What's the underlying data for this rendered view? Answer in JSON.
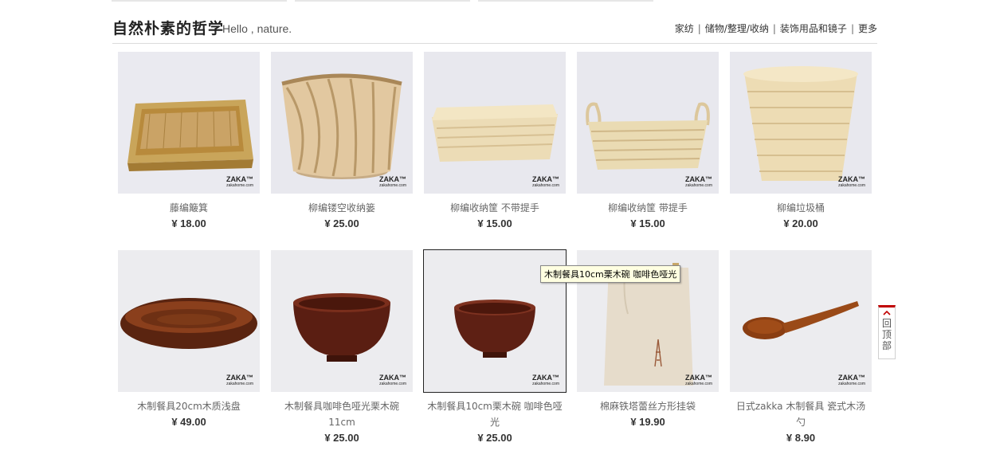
{
  "section": {
    "title": "自然朴素的哲学",
    "subtitle": "Hello , nature.",
    "categories": [
      "家纺",
      "储物/整理/收纳",
      "装饰用品和镜子",
      "更多"
    ]
  },
  "brand": {
    "logo": "ZAKA™",
    "site": "zakahome.com"
  },
  "products": [
    {
      "name": "藤编簸箕",
      "price": "¥ 18.00",
      "icon": "rattan-tray"
    },
    {
      "name": "柳编镂空收纳篓",
      "price": "¥ 25.00",
      "icon": "wicker-basket"
    },
    {
      "name": "柳编收纳筐 不带提手",
      "price": "¥ 15.00",
      "icon": "straw-basket"
    },
    {
      "name": "柳编收纳筐 带提手",
      "price": "¥ 15.00",
      "icon": "straw-basket-handles"
    },
    {
      "name": "柳编垃圾桶",
      "price": "¥ 20.00",
      "icon": "straw-bin"
    },
    {
      "name": "木制餐具20cm木质浅盘",
      "price": "¥ 49.00",
      "icon": "wooden-plate"
    },
    {
      "name": "木制餐具咖啡色哑光栗木碗 11cm",
      "price": "¥ 25.00",
      "icon": "wooden-bowl"
    },
    {
      "name": "木制餐具10cm栗木碗 咖啡色哑光",
      "price": "¥ 25.00",
      "icon": "wooden-bowl-small"
    },
    {
      "name": "棉麻铁塔蕾丝方形挂袋",
      "price": "¥ 19.90",
      "icon": "linen-bag"
    },
    {
      "name": "日式zakka 木制餐具 瓷式木汤勺",
      "price": "¥ 8.90",
      "icon": "wooden-spoon"
    }
  ],
  "tooltip": "木制餐具10cm栗木碗 咖啡色哑光",
  "back_to_top": {
    "label": "回顶部",
    "icon": "chevron-up-icon"
  }
}
